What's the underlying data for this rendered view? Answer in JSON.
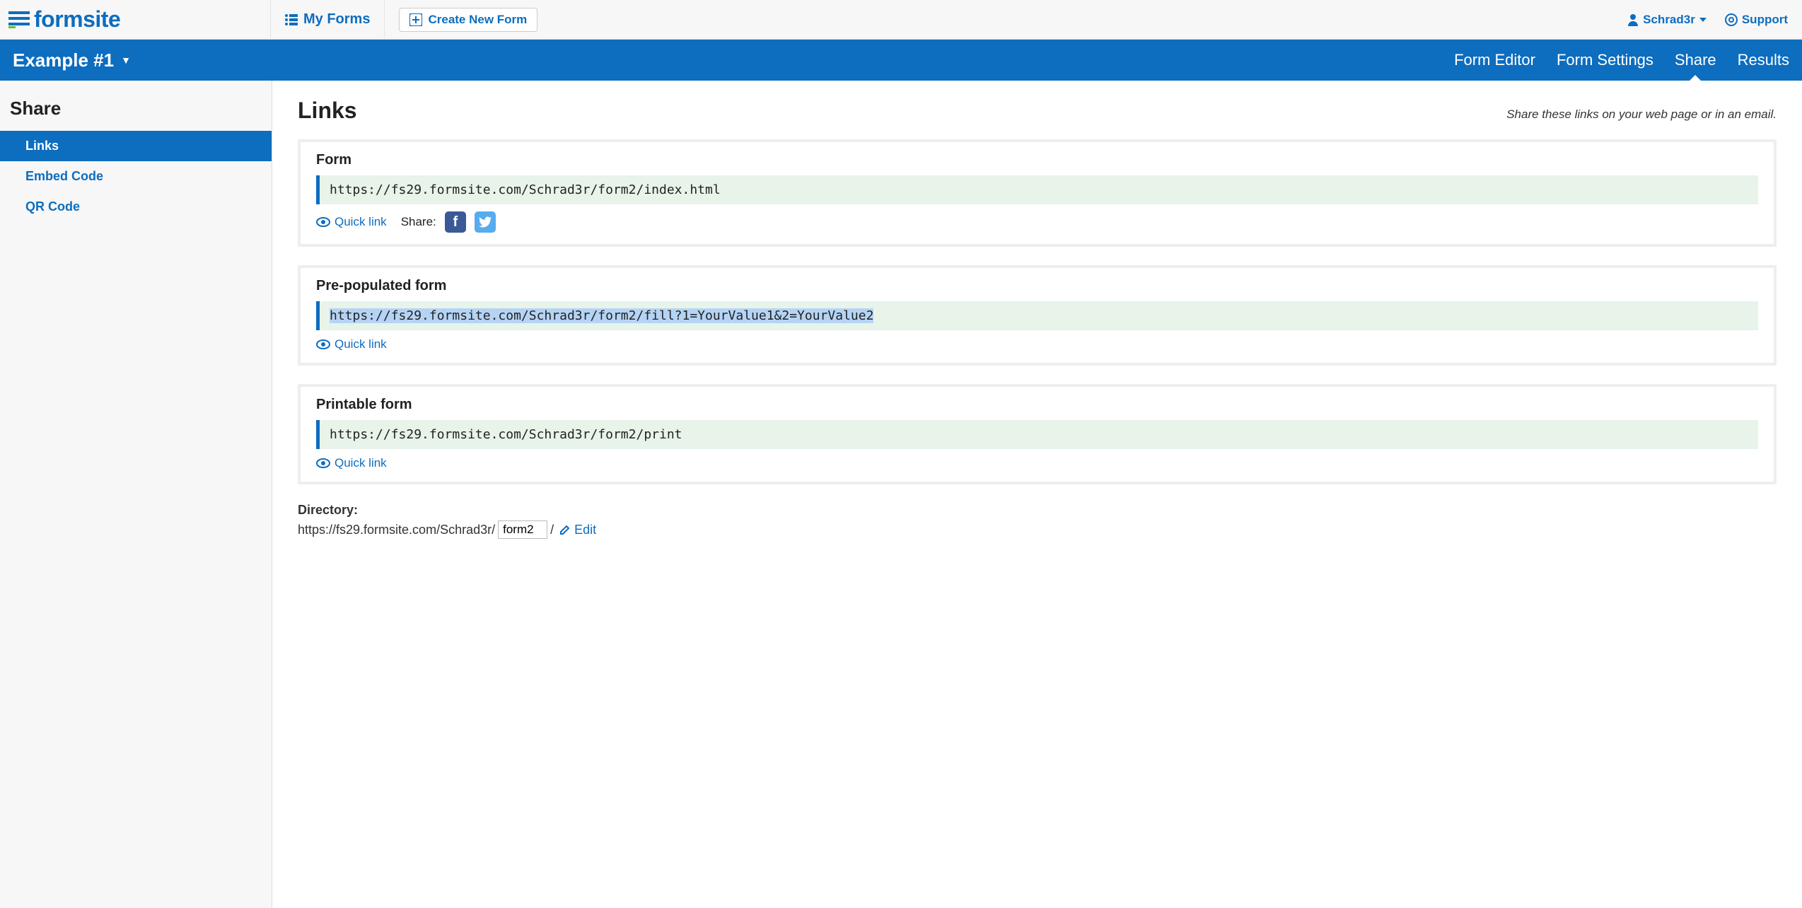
{
  "brand": "formsite",
  "top": {
    "my_forms": "My Forms",
    "create": "Create New Form",
    "user": "Schrad3r",
    "support": "Support"
  },
  "navbar": {
    "form_title": "Example #1",
    "items": [
      "Form Editor",
      "Form Settings",
      "Share",
      "Results"
    ],
    "active": "Share"
  },
  "sidebar": {
    "title": "Share",
    "items": [
      {
        "label": "Links",
        "active": true
      },
      {
        "label": "Embed Code",
        "active": false
      },
      {
        "label": "QR Code",
        "active": false
      }
    ]
  },
  "page": {
    "title": "Links",
    "subtitle": "Share these links on your web page or in an email.",
    "quick_link": "Quick link",
    "share_label": "Share:",
    "cards": [
      {
        "heading": "Form",
        "url": "https://fs29.formsite.com/Schrad3r/form2/index.html",
        "share_social": true,
        "selected": false
      },
      {
        "heading": "Pre-populated form",
        "url": "https://fs29.formsite.com/Schrad3r/form2/fill?1=YourValue1&2=YourValue2",
        "share_social": false,
        "selected": true
      },
      {
        "heading": "Printable form",
        "url": "https://fs29.formsite.com/Schrad3r/form2/print",
        "share_social": false,
        "selected": false
      }
    ],
    "directory": {
      "label": "Directory:",
      "prefix": "https://fs29.formsite.com/Schrad3r/",
      "value": "form2",
      "suffix": "/",
      "edit": "Edit"
    }
  }
}
